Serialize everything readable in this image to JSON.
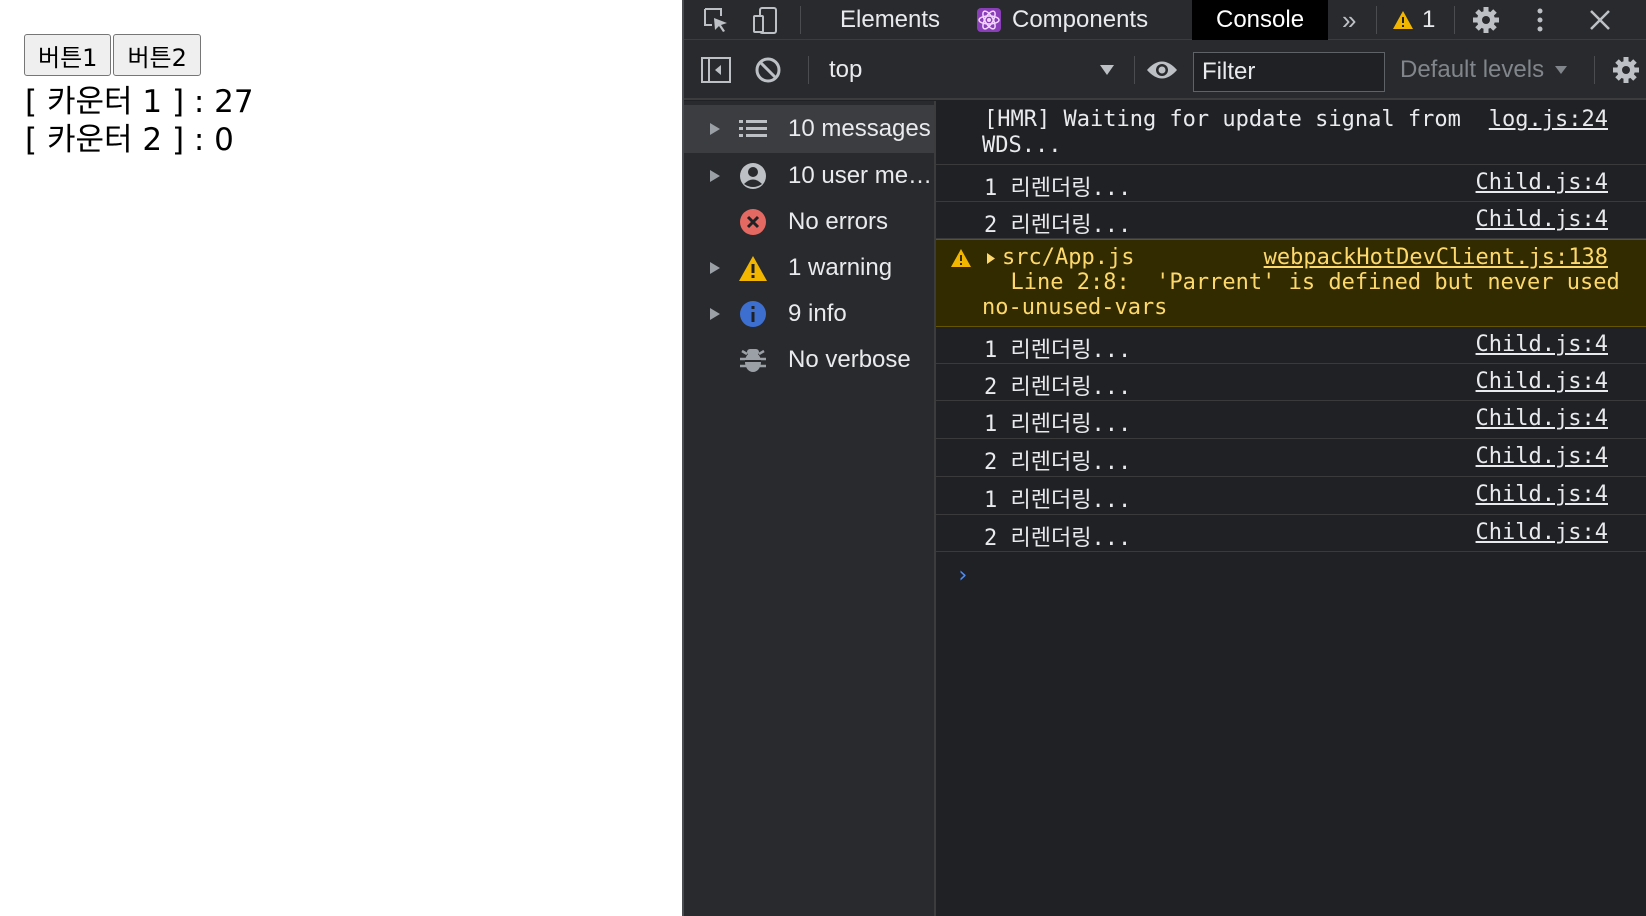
{
  "page": {
    "button1_label": "버튼1",
    "button2_label": "버튼2",
    "counter1_text": "[ 카운터 1 ] : 27",
    "counter2_text": "[ 카운터 2 ] : 0"
  },
  "devtools": {
    "tabs": {
      "elements": "Elements",
      "components": "Components",
      "console": "Console"
    },
    "overflow_label": "»",
    "warning_count": "1",
    "context_select": "top",
    "filter_placeholder": "Filter",
    "levels_label": "Default levels",
    "sidebar": [
      {
        "label": "10 messages",
        "icon": "list-icon"
      },
      {
        "label": "10 user me…",
        "icon": "user-icon"
      },
      {
        "label": "No errors",
        "icon": "error-icon"
      },
      {
        "label": "1 warning",
        "icon": "warning-icon"
      },
      {
        "label": "9 info",
        "icon": "info-icon"
      },
      {
        "label": "No verbose",
        "icon": "bug-icon"
      }
    ],
    "messages": [
      {
        "line1": "[HMR] Waiting for update signal from",
        "line2": "WDS...",
        "source": "log.js:24"
      },
      {
        "text": "1 리렌더링...",
        "source": "Child.js:4"
      },
      {
        "text": "2 리렌더링...",
        "source": "Child.js:4"
      },
      {
        "line1": "src/App.js",
        "line2": "  Line 2:8:  'Parrent' is defined but never used",
        "line3": "no-unused-vars",
        "source": "webpackHotDevClient.js:138"
      },
      {
        "text": "1 리렌더링...",
        "source": "Child.js:4"
      },
      {
        "text": "2 리렌더링...",
        "source": "Child.js:4"
      },
      {
        "text": "1 리렌더링...",
        "source": "Child.js:4"
      },
      {
        "text": "2 리렌더링...",
        "source": "Child.js:4"
      },
      {
        "text": "1 리렌더링...",
        "source": "Child.js:4"
      },
      {
        "text": "2 리렌더링...",
        "source": "Child.js:4"
      }
    ],
    "prompt": "›",
    "colors": {
      "background": "#202124",
      "panel": "#292a2d",
      "warning_bg": "#332b00",
      "warning_text": "#fdd86d",
      "error_red": "#e46962",
      "info_blue": "#3d6fd1",
      "prompt_blue": "#4e8ef7"
    }
  }
}
